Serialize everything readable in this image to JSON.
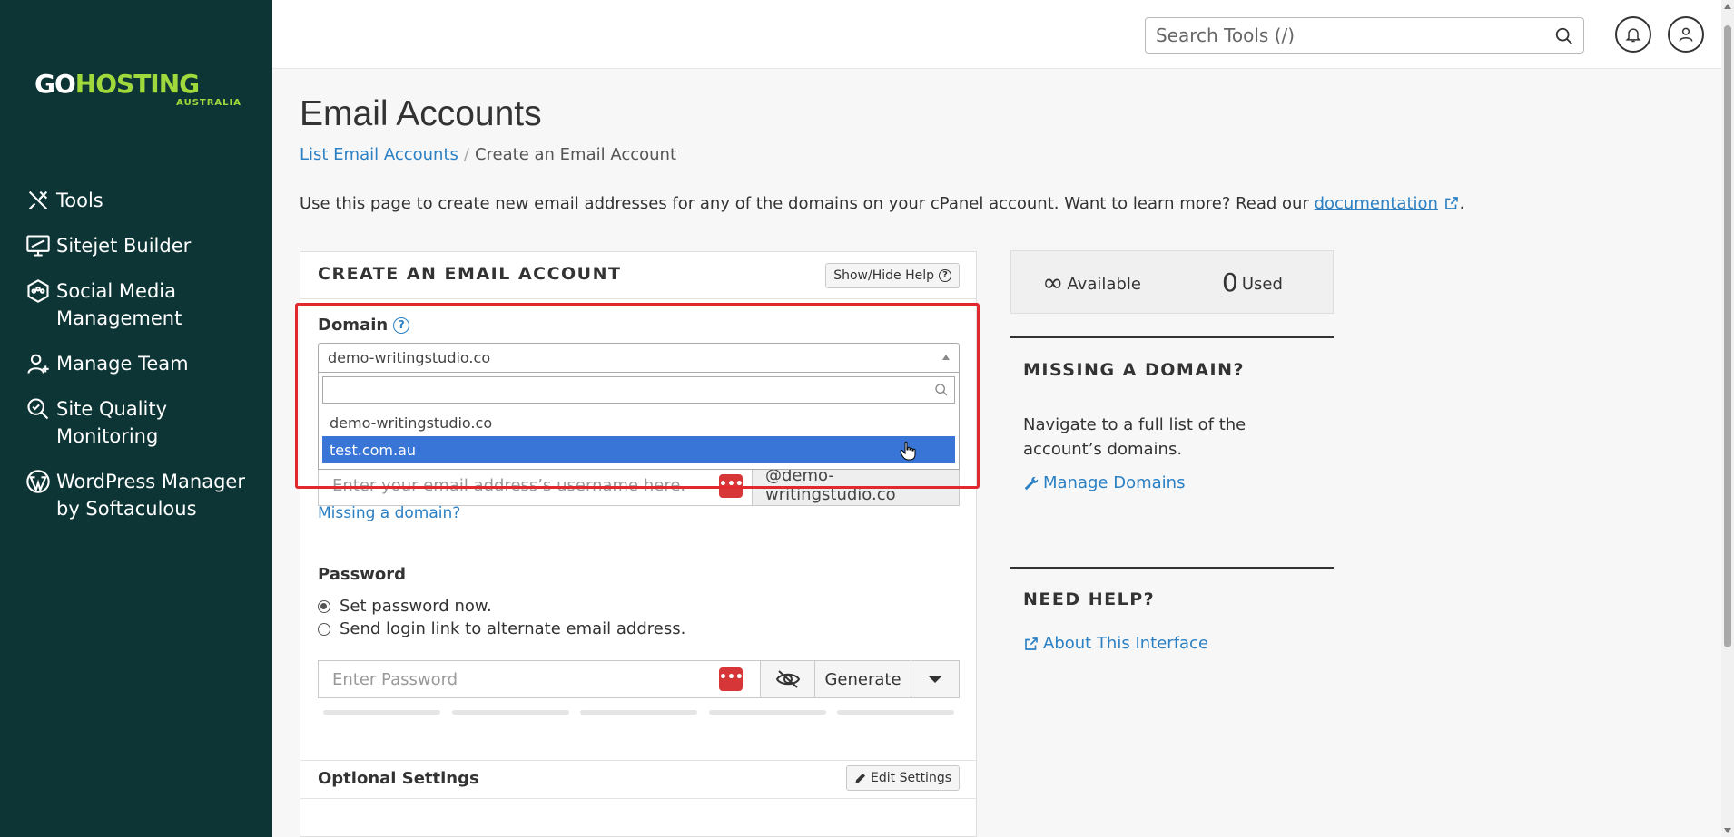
{
  "brand": {
    "name_part1": "GO",
    "name_part2": "HOSTING",
    "subtitle": "AUSTRALIA"
  },
  "sidebar": {
    "items": [
      {
        "label": "Tools",
        "icon": "tools-icon"
      },
      {
        "label": "Sitejet Builder",
        "icon": "monitor-icon"
      },
      {
        "label": "Social Media Management",
        "icon": "social-icon"
      },
      {
        "label": "Manage Team",
        "icon": "user-plus-icon"
      },
      {
        "label": "Site Quality Monitoring",
        "icon": "search-check-icon"
      },
      {
        "label": "WordPress Manager by Softaculous",
        "icon": "wordpress-icon"
      }
    ]
  },
  "header": {
    "search_placeholder": "Search Tools (/)"
  },
  "page": {
    "title": "Email Accounts",
    "breadcrumb": {
      "link": "List Email Accounts",
      "separator": "/",
      "current": "Create an Email Account"
    },
    "intro_text": "Use this page to create new email addresses for any of the domains on your cPanel account. Want to learn more? Read our ",
    "intro_link": "documentation",
    "intro_end": "."
  },
  "form": {
    "title": "CREATE AN EMAIL ACCOUNT",
    "help_button": "Show/Hide Help",
    "domain_label": "Domain",
    "domain_selected": "demo-writingstudio.co",
    "domain_search_value": "",
    "domain_options": [
      "demo-writingstudio.co",
      "test.com.au"
    ],
    "domain_highlighted": "test.com.au",
    "username_placeholder": "Enter your email address’s username here.",
    "username_suffix": "@demo-writingstudio.co",
    "missing_domain_link": "Missing a domain?",
    "password_label": "Password",
    "password_options": [
      "Set password now.",
      "Send login link to alternate email address."
    ],
    "password_placeholder": "Enter Password",
    "generate_label": "Generate",
    "optional_settings": "Optional Settings",
    "edit_settings": "Edit Settings",
    "pw_manager_dots": "•••"
  },
  "stats": {
    "available_symbol": "∞",
    "available_label": "Available",
    "used_value": "0",
    "used_label": "Used"
  },
  "right": {
    "missing_title": "MISSING A DOMAIN?",
    "missing_text": "Navigate to a full list of the account’s domains.",
    "manage_domains": "Manage Domains",
    "help_title": "NEED HELP?",
    "about_link": "About This Interface"
  },
  "colors": {
    "sidebar_bg": "#0e3535",
    "brand_green": "#9fd93b",
    "link": "#2b80c4",
    "highlight": "#3875d7",
    "alert_red": "#e0282e"
  }
}
